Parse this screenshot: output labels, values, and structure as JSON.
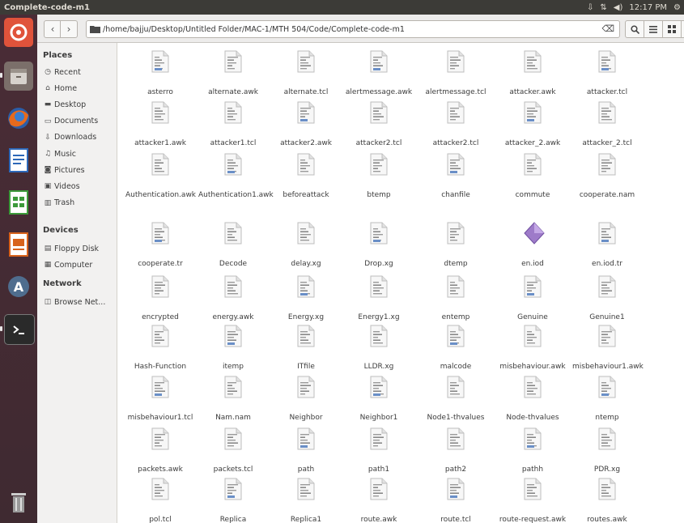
{
  "window": {
    "title": "Complete-code-m1"
  },
  "top_panel": {
    "keyboard": "⇩",
    "network": "⇅",
    "volume": "◀)",
    "clock": "12:17 PM",
    "gear": "⚙"
  },
  "toolbar": {
    "back": "‹",
    "forward": "›",
    "path": "/home/bajju/Desktop/Untitled Folder/MAC-1/MTH 504/Code/Complete-code-m1",
    "search_icon": "search-icon",
    "list_view_icon": "list-icon",
    "grid_view_icon": "grid-icon",
    "dropdown": "⌄"
  },
  "sidebar": {
    "places_heading": "Places",
    "places": [
      {
        "label": "Recent",
        "icon": "clock-icon"
      },
      {
        "label": "Home",
        "icon": "home-icon"
      },
      {
        "label": "Desktop",
        "icon": "desktop-icon"
      },
      {
        "label": "Documents",
        "icon": "documents-icon"
      },
      {
        "label": "Downloads",
        "icon": "download-icon"
      },
      {
        "label": "Music",
        "icon": "music-icon"
      },
      {
        "label": "Pictures",
        "icon": "camera-icon"
      },
      {
        "label": "Videos",
        "icon": "video-icon"
      },
      {
        "label": "Trash",
        "icon": "trash-icon"
      }
    ],
    "devices_heading": "Devices",
    "devices": [
      {
        "label": "Floppy Disk",
        "icon": "floppy-icon"
      },
      {
        "label": "Computer",
        "icon": "computer-icon"
      }
    ],
    "network_heading": "Network",
    "network": [
      {
        "label": "Browse Net...",
        "icon": "network-icon"
      }
    ]
  },
  "files": [
    [
      "asterro",
      "alternate.awk",
      "alternate.tcl",
      "alertmessage.awk",
      "alertmessage.tcl",
      "attacker.awk",
      "attacker.tcl"
    ],
    [
      "attacker1.awk",
      "attacker1.tcl",
      "attacker2.awk",
      "attacker2.tcl",
      "attacker2.tcl",
      "attacker_2.awk",
      "attacker_2.tcl"
    ],
    [
      "Authentication.awk",
      "Authentication1.awk",
      "beforeattack",
      "btemp",
      "chanfile",
      "commute",
      "cooperate.nam"
    ],
    [
      "cooperate.tr",
      "Decode",
      "delay.xg",
      "Drop.xg",
      "dtemp",
      "en.iod",
      "en.iod.tr"
    ],
    [
      "encrypted",
      "energy.awk",
      "Energy.xg",
      "Energy1.xg",
      "entemp",
      "Genuine",
      "Genuine1"
    ],
    [
      "Hash-Function",
      "itemp",
      "ITfile",
      "LLDR.xg",
      "malcode",
      "misbehaviour.awk",
      "misbehaviour1.awk"
    ],
    [
      "misbehaviour1.tcl",
      "Nam.nam",
      "Neighbor",
      "Neighbor1",
      "Node1-thvalues",
      "Node-thvalues",
      "ntemp"
    ],
    [
      "packets.awk",
      "packets.tcl",
      "path",
      "path1",
      "path2",
      "pathh",
      "PDR.xg"
    ],
    [
      "pol.tcl",
      "Replica",
      "Replica1",
      "route.awk",
      "route.tcl",
      "route-request.awk",
      "routes.awk"
    ]
  ]
}
